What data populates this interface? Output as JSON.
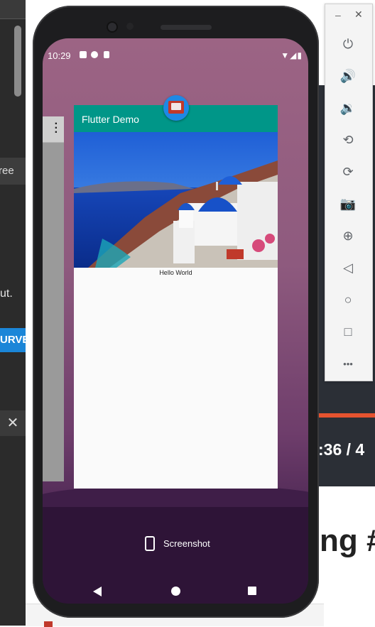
{
  "background": {
    "left_tree_text": "ree",
    "left_ut_text": "ut.",
    "left_survey_text": "URVE",
    "left_close_text": "✕",
    "right_time_text": ":36 / 4",
    "right_heading_text": "ng #"
  },
  "phone": {
    "status_time": "10:29",
    "status_right": "▼◢▮",
    "recents": {
      "app_title": "Flutter Demo",
      "body_text": "Hello World",
      "screenshot_label": "Screenshot"
    }
  },
  "emulator_toolbar": {
    "minimize": "–",
    "close": "✕",
    "buttons": [
      "power-icon",
      "volume-up-icon",
      "volume-down-icon",
      "rotate-left-icon",
      "rotate-right-icon",
      "camera-icon",
      "zoom-icon",
      "back-icon",
      "home-icon",
      "overview-icon",
      "more-icon"
    ],
    "glyphs": {
      "power": "⏻",
      "volume_up": "🔊",
      "volume_down": "🔉",
      "rotate_left": "⟲",
      "rotate_right": "⟳",
      "camera": "📷",
      "zoom": "⊕",
      "back": "◁",
      "home": "○",
      "overview": "□",
      "more": "•••"
    }
  },
  "colors": {
    "appbar": "#009688",
    "app_icon": "#1e88e5",
    "survey_button": "#1b86d8",
    "accent_orange": "#e5532f"
  }
}
